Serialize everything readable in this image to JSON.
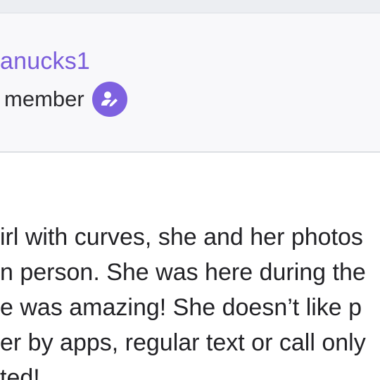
{
  "profile": {
    "username": "anucks1",
    "role_label": "member",
    "badge_icon": "user-edit-icon",
    "accent_color": "#7a5cdb"
  },
  "post": {
    "lines": [
      "irl with curves, she and her photos",
      "n person. She was here during the",
      "e was amazing! She doesn’t like p",
      "er by apps, regular text or call only",
      "ted!"
    ]
  }
}
